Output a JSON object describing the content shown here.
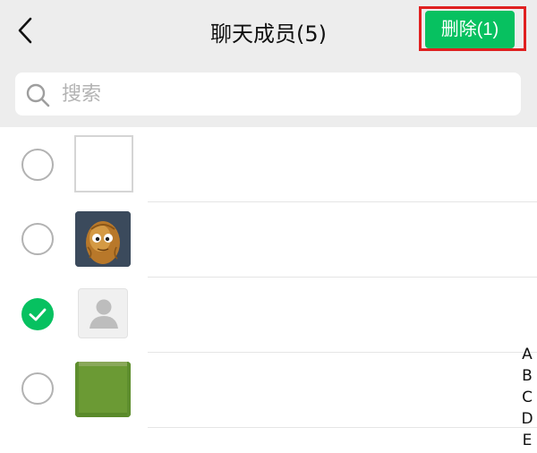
{
  "header": {
    "title": "聊天成员(5)",
    "delete_label": "删除(1)",
    "back_icon": "chevron-left-icon"
  },
  "search": {
    "placeholder": "搜索",
    "value": "",
    "icon": "search-icon"
  },
  "members": [
    {
      "selected": false,
      "avatar": "blank-avatar"
    },
    {
      "selected": false,
      "avatar": "wallnut-avatar"
    },
    {
      "selected": true,
      "avatar": "default-person-avatar"
    },
    {
      "selected": false,
      "avatar": "green-avatar"
    }
  ],
  "index": [
    "A",
    "B",
    "C",
    "D",
    "E"
  ],
  "colors": {
    "accent": "#07c160",
    "highlight_outline": "#e02020",
    "header_bg": "#ededed"
  }
}
